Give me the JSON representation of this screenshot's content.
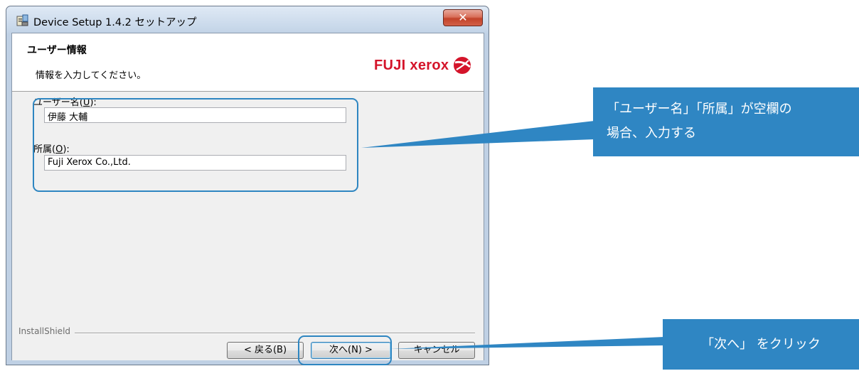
{
  "window": {
    "title": "Device Setup 1.4.2 セットアップ",
    "close_glyph": "✕"
  },
  "header": {
    "title": "ユーザー情報",
    "subtitle": "情報を入力してください。",
    "logo_text": "FUJI xerox"
  },
  "form": {
    "username_label": "ユーザー名(",
    "username_mnemonic": "U",
    "username_label_end": "):",
    "username_value": "伊藤  大輔",
    "org_label": "所属(",
    "org_mnemonic": "O",
    "org_label_end": "):",
    "org_value": "Fuji Xerox Co.,Ltd."
  },
  "footer": {
    "brand": "InstallShield",
    "back_label": "< 戻る(B)",
    "next_label": "次へ(N) >",
    "cancel_label": "キャンセル"
  },
  "annotations": {
    "fields_note_line1": "「ユーザー名」「所属」が空欄の",
    "fields_note_line2": "場合、入力する",
    "next_note": "「次へ」 をクリック"
  },
  "colors": {
    "accent": "#2f86c3",
    "logo_red": "#d4142a"
  }
}
